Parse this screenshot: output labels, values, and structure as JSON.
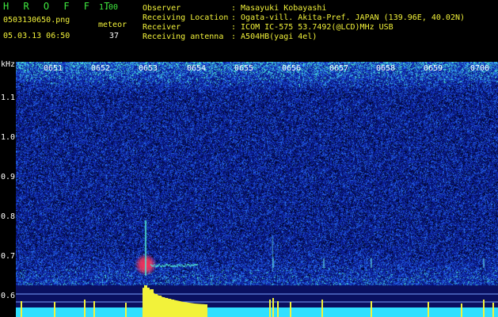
{
  "app": {
    "logo_text": "H R O F F T",
    "version": "1.00",
    "filename": "0503130650.png",
    "datetime": "05.03.13 06:50",
    "mode_label": "meteor",
    "count": "37"
  },
  "info": {
    "labels": [
      "Observer",
      "Receiving Location",
      "Receiver",
      "Receiving antenna"
    ],
    "values": [
      ": Masayuki Kobayashi",
      ": Ogata-vill. Akita-Pref. JAPAN (139.96E, 40.02N)",
      ": ICOM IC-575 53.7492(@LCD)MHz USB",
      ": A504HB(yagi 4el)"
    ]
  },
  "axis": {
    "unit": "kHz",
    "y_ticks": [
      "1.1",
      "1.0",
      "0.9",
      "0.8",
      "0.7",
      "0.6"
    ],
    "time_ticks": [
      "0651",
      "0652",
      "0653",
      "0654",
      "0655",
      "0656",
      "0657",
      "0658",
      "0659",
      "0700"
    ]
  },
  "colors": {
    "background": "#000000",
    "noise_low": "#0a1a8c",
    "noise_mid": "#2a56e0",
    "noise_high": "#3fd2d2",
    "meteor_core": "#ff2a55",
    "signal_bars": "#f2f23a",
    "baseline": "#2fe0ff",
    "logo": "#3fe83f",
    "text": "#ffffff",
    "header_accent": "#f2f23a"
  }
}
